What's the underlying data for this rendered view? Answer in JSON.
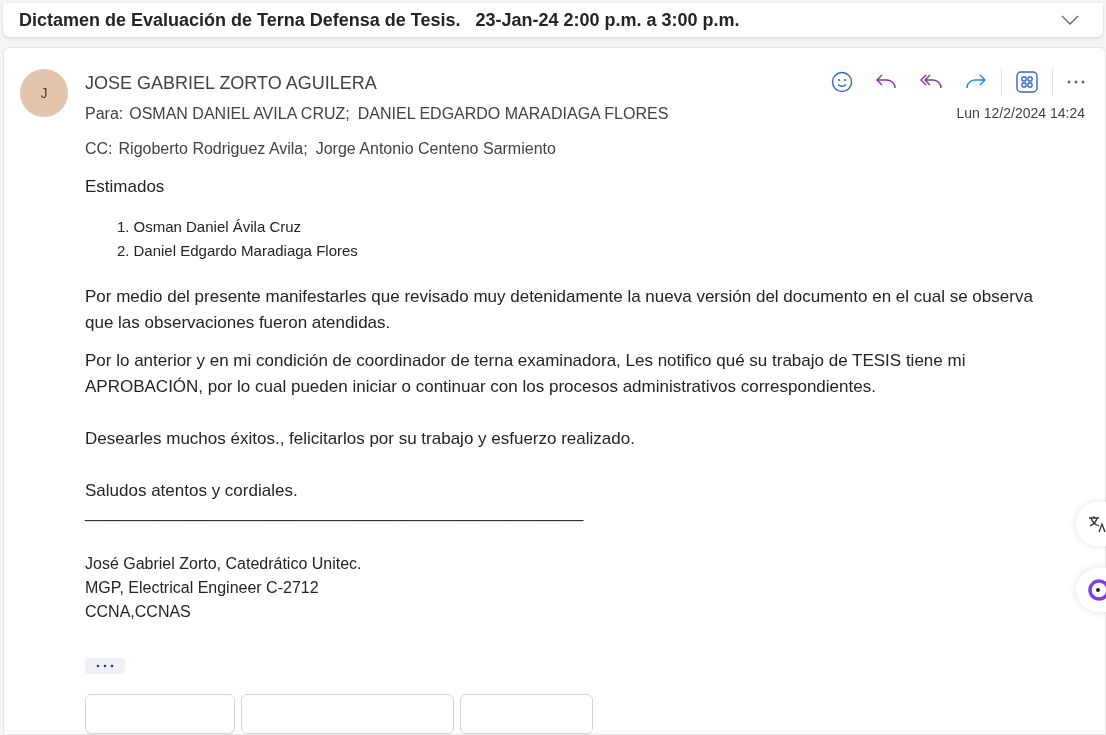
{
  "subject": "Dictamen de Evaluación de Terna Defensa de Tesis.   23-Jan-24 2:00 p.m. a 3:00 p.m.",
  "message": {
    "avatar_initial": "J",
    "sender": "JOSE GABRIEL ZORTO AGUILERA",
    "to_label": "Para:",
    "to": [
      "OSMAN DANIEL AVILA CRUZ;",
      "DANIEL EDGARDO MARADIAGA FLORES"
    ],
    "cc_label": "CC:",
    "cc": [
      "Rigoberto Rodriguez Avila;",
      "Jorge Antonio Centeno Sarmiento"
    ],
    "date": "Lun 12/2/2024 14:24"
  },
  "body": {
    "greeting": "Estimados",
    "list": [
      {
        "number": "1.",
        "text": "Osman Daniel Ávila Cruz"
      },
      {
        "number": "2.",
        "text": "Daniel Edgardo Maradiaga Flores"
      }
    ],
    "paragraphs": [
      "Por medio del presente manifestarles que revisado muy detenidamente la nueva versión del documento en el cual se observa que las observaciones fueron atendidas.",
      "Por lo anterior y en mi condición de coordinador de terna examinadora, Les notifico qué su trabajo de TESIS tiene mi  APROBACIÓN, por lo cual pueden iniciar o continuar con los procesos administrativos correspondientes.",
      "Desearles muchos éxitos., felicitarlos por su trabajo y esfuerzo realizado.",
      "Saludos atentos y cordiales."
    ],
    "rule": "________________________________________________________",
    "signature": [
      "José Gabriel Zorto, Catedrático Unitec.",
      "MGP, Electrical Engineer C-2712",
      "CCNA,CCNAS"
    ]
  }
}
